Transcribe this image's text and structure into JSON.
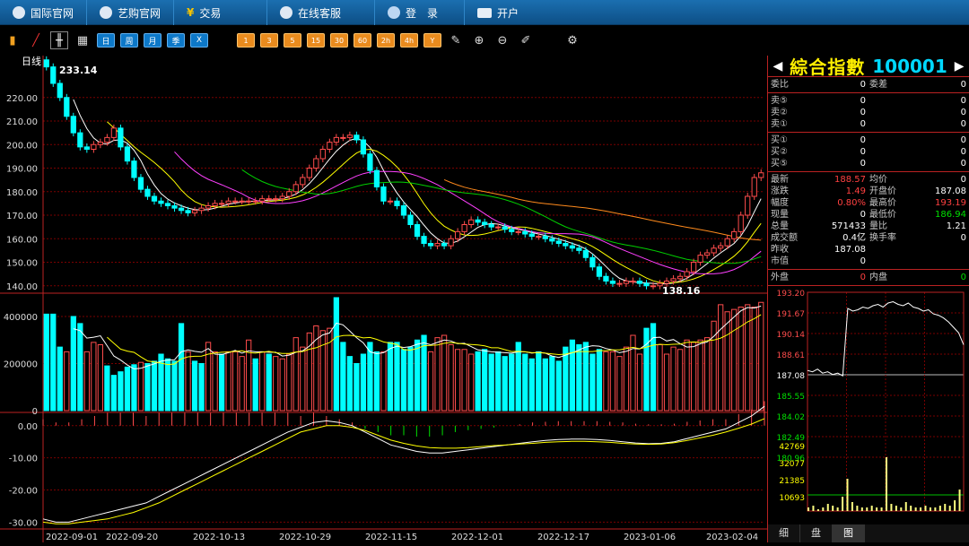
{
  "nav": {
    "items": [
      {
        "label": "国际官网",
        "icon": "globe-icon"
      },
      {
        "label": "艺购官网",
        "icon": "link-icon"
      },
      {
        "label": "交易",
        "icon": "yen-icon"
      },
      {
        "label": "在线客服",
        "icon": "chat-icon"
      },
      {
        "label": "登　录",
        "icon": "user-icon"
      },
      {
        "label": "开户",
        "icon": "monitor-icon"
      }
    ]
  },
  "toolbar": {
    "period_labels": [
      "日",
      "周",
      "月",
      "季",
      "X"
    ],
    "minute_labels": [
      "1",
      "3",
      "5",
      "15",
      "30",
      "60",
      "2h",
      "4h",
      "Y"
    ]
  },
  "chart_data": [
    {
      "type": "candlestick",
      "title": "日线",
      "ylim": [
        138,
        234
      ],
      "yticks": [
        140,
        150,
        160,
        170,
        180,
        190,
        200,
        210,
        220
      ],
      "x_ticks": [
        "2022-09-01",
        "2022-09-20",
        "2022-10-13",
        "2022-10-29",
        "2022-11-15",
        "2022-12-01",
        "2022-12-17",
        "2023-01-06",
        "2023-02-04"
      ],
      "annotations": [
        {
          "label": "233.14"
        },
        {
          "label": "138.16"
        }
      ],
      "series": [
        {
          "values": [
            233,
            226,
            220,
            212,
            205,
            199,
            198,
            200,
            201,
            203,
            207,
            199,
            193,
            186,
            181,
            178,
            176,
            175,
            174,
            173,
            172,
            171,
            172,
            173,
            174,
            175,
            175,
            176,
            176,
            176,
            176,
            176,
            177,
            177,
            177,
            178,
            180,
            183,
            186,
            190,
            194,
            198,
            201,
            203,
            203,
            204,
            202,
            196,
            189,
            182,
            176,
            176,
            174,
            170,
            166,
            161,
            158,
            157,
            158,
            157,
            160,
            163,
            166,
            168,
            167,
            166,
            165,
            165,
            164,
            163,
            163,
            162,
            161,
            161,
            160,
            159,
            158,
            157,
            156,
            155,
            152,
            148,
            144,
            142,
            141,
            141,
            142,
            142,
            141,
            140,
            140,
            141,
            142,
            143,
            144,
            146,
            150,
            153,
            154,
            156,
            157,
            160,
            163,
            170,
            178,
            186,
            188
          ]
        }
      ]
    },
    {
      "type": "bar",
      "title": "volume",
      "ylim": [
        0,
        480000
      ],
      "yticks": [
        200000,
        400000
      ],
      "values": [
        410000,
        410000,
        270000,
        250000,
        400000,
        370000,
        250000,
        290000,
        280000,
        190000,
        150000,
        165000,
        185000,
        195000,
        205000,
        200000,
        210000,
        240000,
        220000,
        210000,
        370000,
        250000,
        210000,
        200000,
        290000,
        250000,
        240000,
        250000,
        250000,
        230000,
        300000,
        220000,
        250000,
        240000,
        230000,
        220000,
        240000,
        310000,
        270000,
        330000,
        360000,
        340000,
        350000,
        480000,
        290000,
        230000,
        200000,
        240000,
        290000,
        250000,
        250000,
        290000,
        290000,
        260000,
        270000,
        300000,
        320000,
        250000,
        310000,
        320000,
        280000,
        260000,
        260000,
        240000,
        250000,
        260000,
        240000,
        250000,
        230000,
        240000,
        290000,
        240000,
        220000,
        250000,
        220000,
        230000,
        210000,
        270000,
        300000,
        280000,
        290000,
        240000,
        260000,
        250000,
        250000,
        230000,
        270000,
        320000,
        240000,
        350000,
        370000,
        280000,
        240000,
        270000,
        260000,
        300000,
        290000,
        300000,
        310000,
        380000,
        450000,
        420000,
        430000,
        440000,
        450000,
        440000,
        460000
      ],
      "up": [
        0,
        0,
        0,
        1,
        0,
        0,
        1,
        1,
        1,
        0,
        0,
        0,
        0,
        0,
        1,
        0,
        0,
        0,
        0,
        0,
        0,
        1,
        0,
        0,
        1,
        1,
        0,
        1,
        1,
        1,
        1,
        0,
        1,
        0,
        1,
        1,
        1,
        1,
        1,
        1,
        1,
        1,
        1,
        0,
        0,
        0,
        0,
        0,
        0,
        0,
        1,
        0,
        0,
        0,
        0,
        0,
        0,
        1,
        1,
        1,
        1,
        1,
        1,
        1,
        0,
        0,
        0,
        0,
        0,
        0,
        0,
        0,
        0,
        0,
        0,
        0,
        0,
        0,
        0,
        0,
        0,
        0,
        0,
        1,
        1,
        1,
        1,
        1,
        1,
        0,
        0,
        1,
        1,
        1,
        1,
        1,
        1,
        1,
        1,
        1,
        1,
        1,
        1,
        1,
        1,
        1,
        1
      ]
    },
    {
      "type": "line",
      "title": "MACD",
      "ylim": [
        -31,
        3
      ],
      "yticks": [
        0,
        -10,
        -20,
        -30
      ],
      "series": [
        {
          "values": [
            -29,
            -30,
            -30,
            -29,
            -28,
            -27,
            -26,
            -25,
            -24,
            -22,
            -20,
            -18,
            -16,
            -14,
            -12,
            -10,
            -8,
            -6,
            -4,
            -2,
            -0.5,
            1,
            1.5,
            1,
            0,
            -2,
            -4,
            -6,
            -7,
            -8,
            -8.5,
            -8.5,
            -8,
            -7.5,
            -7,
            -6.5,
            -6,
            -5.5,
            -5,
            -4.6,
            -4.3,
            -4.2,
            -4.2,
            -4.3,
            -4.6,
            -5,
            -5.4,
            -5.6,
            -5.5,
            -5,
            -4,
            -3,
            -2,
            -1,
            1,
            3,
            6
          ]
        },
        {
          "values": [
            -30,
            -30.5,
            -30.5,
            -30,
            -29.5,
            -29,
            -28,
            -27,
            -25.5,
            -24,
            -22,
            -20,
            -18,
            -16,
            -14,
            -12,
            -10,
            -8,
            -6,
            -4,
            -2,
            -1,
            0,
            0,
            -0.5,
            -1.5,
            -3,
            -4.5,
            -5.5,
            -6.3,
            -6.8,
            -7,
            -7,
            -6.8,
            -6.5,
            -6.2,
            -6,
            -5.7,
            -5.5,
            -5.2,
            -5,
            -4.9,
            -4.9,
            -5,
            -5.2,
            -5.5,
            -5.7,
            -5.8,
            -5.7,
            -5.3,
            -4.6,
            -3.8,
            -3,
            -2,
            -0.8,
            0.5,
            2.2
          ]
        }
      ]
    }
  ],
  "side": {
    "title": "綜合指數",
    "code": "100001",
    "rows_top": [
      {
        "l": "委比",
        "v": "0",
        "l2": "委差",
        "v2": "0"
      }
    ],
    "asks": [
      {
        "l": "卖⑤",
        "v": "0",
        "v2": "0"
      },
      {
        "l": "卖②",
        "v": "0",
        "v2": "0"
      },
      {
        "l": "卖①",
        "v": "0",
        "v2": "0"
      }
    ],
    "bids": [
      {
        "l": "买①",
        "v": "0",
        "v2": "0"
      },
      {
        "l": "买②",
        "v": "0",
        "v2": "0"
      },
      {
        "l": "买⑤",
        "v": "0",
        "v2": "0"
      }
    ],
    "stats": [
      {
        "l": "最新",
        "v": "188.57",
        "vc": "red",
        "l2": "均价",
        "v2": "0",
        "v2c": "white"
      },
      {
        "l": "涨跌",
        "v": "1.49",
        "vc": "red",
        "l2": "开盘价",
        "v2": "187.08",
        "v2c": "white"
      },
      {
        "l": "幅度",
        "v": "0.80%",
        "vc": "red",
        "l2": "最高价",
        "v2": "193.19",
        "v2c": "red"
      },
      {
        "l": "现量",
        "v": "0",
        "vc": "white",
        "l2": "最低价",
        "v2": "186.94",
        "v2c": "green"
      },
      {
        "l": "总量",
        "v": "571433",
        "vc": "white",
        "l2": "量比",
        "v2": "1.21",
        "v2c": "white"
      },
      {
        "l": "成交额",
        "v": "0.4亿",
        "vc": "white",
        "l2": "换手率",
        "v2": "0",
        "v2c": "white"
      },
      {
        "l": "昨收",
        "v": "187.08",
        "vc": "white",
        "l2": "",
        "v2": "",
        "v2c": "white"
      },
      {
        "l": "市值",
        "v": "0",
        "vc": "white",
        "l2": "",
        "v2": "",
        "v2c": "white"
      }
    ],
    "outer": {
      "l": "外盘",
      "v": "0",
      "l2": "内盘",
      "v2": "0"
    },
    "mini_price_ticks": [
      "193.20",
      "191.67",
      "190.14",
      "188.61",
      "187.08",
      "185.55",
      "184.02",
      "182.49",
      "180.96"
    ],
    "mini_vol_ticks": [
      "42769",
      "32077",
      "21385",
      "10693"
    ],
    "tabs": [
      "细",
      "盘",
      "图"
    ]
  }
}
